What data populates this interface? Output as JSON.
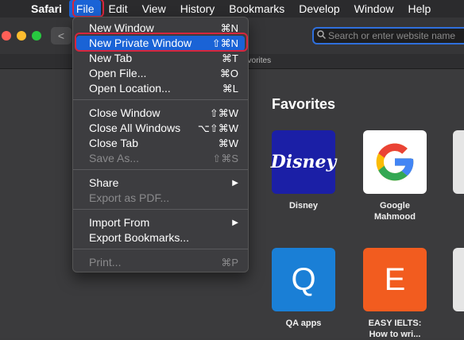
{
  "menubar": {
    "app": "Safari",
    "items": [
      "File",
      "Edit",
      "View",
      "History",
      "Bookmarks",
      "Develop",
      "Window",
      "Help"
    ]
  },
  "toolbar": {
    "back": "<",
    "search_placeholder": "Search or enter website name"
  },
  "tab": {
    "title": "Favorites"
  },
  "favorites": {
    "heading": "Favorites",
    "tiles": [
      {
        "label": "Disney",
        "glyph": "Disney",
        "color": "#1b1fa6"
      },
      {
        "label": "Google\nMahmood",
        "glyph": "G",
        "color": "#ffffff"
      },
      {
        "label": "QA apps",
        "glyph": "Q",
        "color": "#1a7fd6"
      },
      {
        "label": "EASY IELTS:\nHow to wri...",
        "glyph": "E",
        "color": "#f25c1f"
      }
    ]
  },
  "file_menu": {
    "items": [
      {
        "label": "New Window",
        "shortcut": "⌘N"
      },
      {
        "label": "New Private Window",
        "shortcut": "⇧⌘N"
      },
      {
        "label": "New Tab",
        "shortcut": "⌘T"
      },
      {
        "label": "Open File...",
        "shortcut": "⌘O"
      },
      {
        "label": "Open Location...",
        "shortcut": "⌘L"
      },
      {
        "label": "Close Window",
        "shortcut": "⇧⌘W"
      },
      {
        "label": "Close All Windows",
        "shortcut": "⌥⇧⌘W"
      },
      {
        "label": "Close Tab",
        "shortcut": "⌘W"
      },
      {
        "label": "Save As...",
        "shortcut": "⇧⌘S"
      },
      {
        "label": "Share",
        "shortcut": "▶"
      },
      {
        "label": "Export as PDF...",
        "shortcut": ""
      },
      {
        "label": "Import From",
        "shortcut": "▶"
      },
      {
        "label": "Export Bookmarks...",
        "shortcut": ""
      },
      {
        "label": "Print...",
        "shortcut": "⌘P"
      }
    ]
  },
  "colors": {
    "highlight": "#1a63d6",
    "annotation": "#d7263d"
  }
}
